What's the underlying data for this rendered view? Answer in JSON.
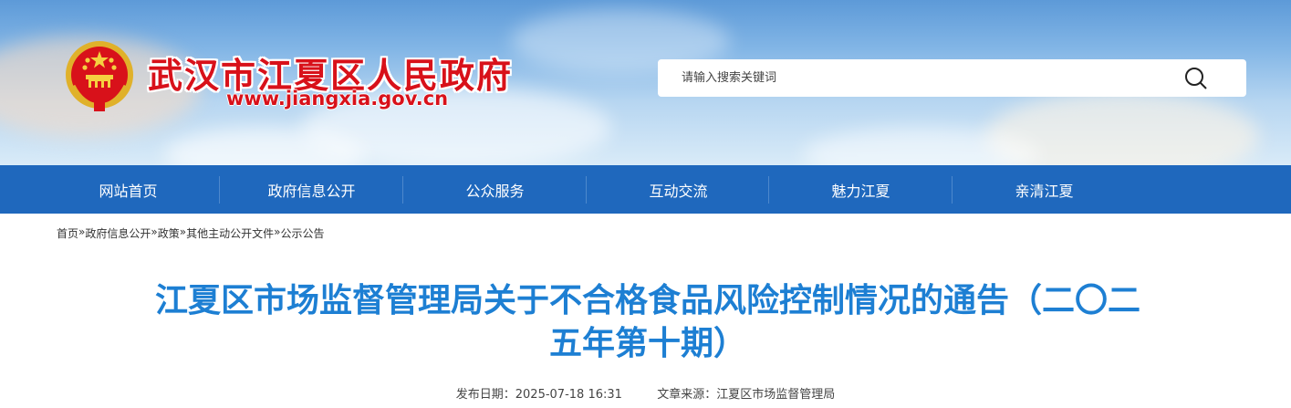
{
  "header": {
    "site_title": "武汉市江夏区人民政府",
    "site_url": "www.jiangxia.gov.cn",
    "search": {
      "placeholder": "请输入搜索关键词",
      "icon": "search-icon"
    },
    "emblem_icon": "national-emblem-icon"
  },
  "nav": {
    "items": [
      {
        "label": "网站首页"
      },
      {
        "label": "政府信息公开"
      },
      {
        "label": "公众服务"
      },
      {
        "label": "互动交流"
      },
      {
        "label": "魅力江夏"
      },
      {
        "label": "亲清江夏"
      }
    ],
    "background_color": "#1f68bd"
  },
  "breadcrumb": {
    "items": [
      "首页",
      "政府信息公开",
      "政策",
      "其他主动公开文件",
      "公示公告"
    ],
    "separator": "»"
  },
  "article": {
    "title_line1": "江夏区市场监督管理局关于不合格食品风险控制情况的通告（二〇二",
    "title_line2": "五年第十期）",
    "publish_date_label": "发布日期：2025-07-18 16:31",
    "source_label": "文章来源：江夏区市场监督管理局",
    "title_color": "#1d7fd3"
  }
}
